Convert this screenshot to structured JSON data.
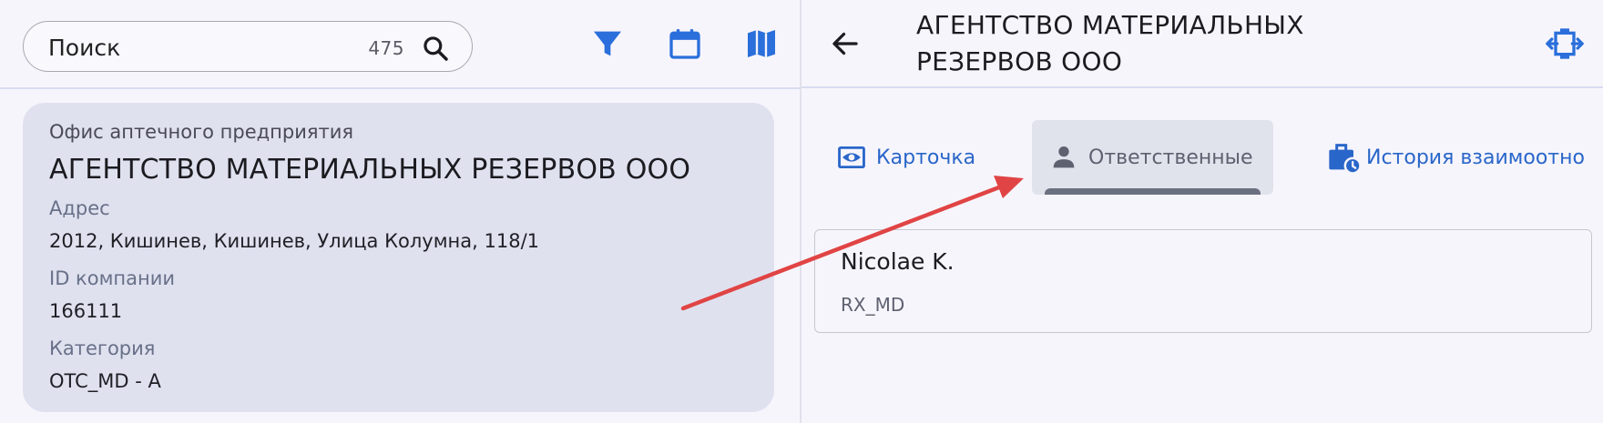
{
  "search": {
    "placeholder": "Поиск",
    "count": "475"
  },
  "toolbar": {
    "icons": [
      "filter-icon",
      "calendar-icon",
      "map-icon"
    ],
    "accent": "#2a6fdb"
  },
  "company_card": {
    "type": "Офис аптечного предприятия",
    "name": "АГЕНТСТВО МАТЕРИАЛЬНЫХ РЕЗЕРВОВ ООО",
    "fields": [
      {
        "label": "Адрес",
        "value": "2012, Кишинев, Кишинев, Улица Колумна, 118/1"
      },
      {
        "label": "ID компании",
        "value": "166111"
      },
      {
        "label": "Категория",
        "value": "OTC_MD - A"
      }
    ],
    "background": "#dfe1ef"
  },
  "detail": {
    "title_line1": "АГЕНТСТВО МАТЕРИАЛЬНЫХ",
    "title_line2": "РЕЗЕРВОВ ООО",
    "tabs": [
      {
        "label": "Карточка",
        "icon": "eye-icon",
        "active": false
      },
      {
        "label": "Ответственные",
        "icon": "person-icon",
        "active": true
      },
      {
        "label": "История взаимоотно",
        "icon": "briefcase-clock-icon",
        "active": false
      }
    ],
    "responsible": {
      "name": "Nicolae K.",
      "role": "RX_MD"
    }
  },
  "colors": {
    "annotation_arrow": "#e04444",
    "link_blue": "#2966c9"
  }
}
